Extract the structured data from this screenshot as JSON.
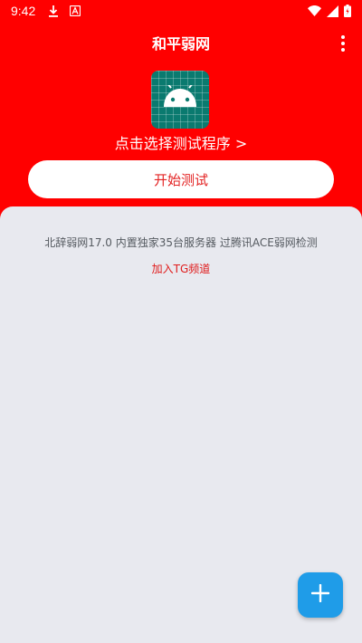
{
  "status_bar": {
    "time": "9:42",
    "left_icons": [
      "download-icon",
      "font-a-icon"
    ],
    "right_icons": [
      "wifi-icon",
      "signal-icon",
      "battery-charging-icon"
    ]
  },
  "app_bar": {
    "title": "和平弱网",
    "menu_icon": "more-vert-icon"
  },
  "header": {
    "app_icon": "android-icon",
    "select_program_label": "点击选择测试程序 >",
    "start_test_label": "开始测试"
  },
  "content": {
    "description": "北辞弱网17.0 内置独家35台服务器 过腾讯ACE弱网检测",
    "tg_link_label": "加入TG频道"
  },
  "fab": {
    "icon": "plus-icon"
  },
  "colors": {
    "primary": "#ff0000",
    "accent_text": "#e32222",
    "card_bg": "#e8e9ef",
    "fab": "#1f9ce8",
    "icon_bg": "#0a7a6f"
  }
}
